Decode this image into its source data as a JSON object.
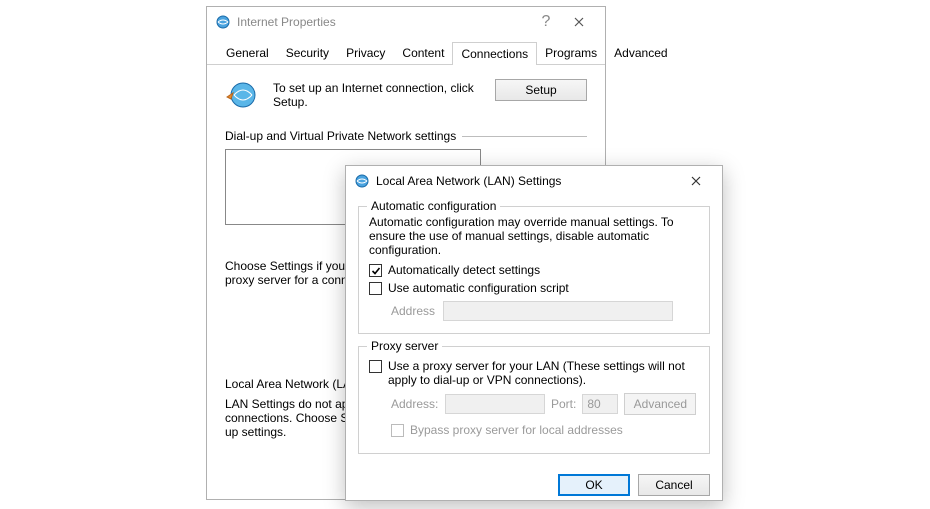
{
  "parent_window": {
    "title": "Internet Properties",
    "tabs": [
      "General",
      "Security",
      "Privacy",
      "Content",
      "Connections",
      "Programs",
      "Advanced"
    ],
    "active_tab_index": 4,
    "setup_text": "To set up an Internet connection, click Setup.",
    "setup_button": "Setup",
    "dialup_label": "Dial-up and Virtual Private Network settings",
    "choose_text": "Choose Settings if you need to configure a proxy server for a connection.",
    "lan_section_label": "Local Area Network (LAN) settings",
    "lan_note": "LAN Settings do not apply to dial-up connections. Choose Settings above for dial-up settings."
  },
  "lan_dialog": {
    "title": "Local Area Network (LAN) Settings",
    "auto_group": {
      "legend": "Automatic configuration",
      "note": "Automatic configuration may override manual settings.  To ensure the use of manual settings, disable automatic configuration.",
      "auto_detect_label": "Automatically detect settings",
      "auto_detect_checked": true,
      "use_script_label": "Use automatic configuration script",
      "use_script_checked": false,
      "address_label": "Address"
    },
    "proxy_group": {
      "legend": "Proxy server",
      "use_proxy_label": "Use a proxy server for your LAN (These settings will not apply to dial-up or VPN connections).",
      "use_proxy_checked": false,
      "address_label": "Address:",
      "address_value": "",
      "port_label": "Port:",
      "port_value": "80",
      "advanced_button": "Advanced",
      "bypass_label": "Bypass proxy server for local addresses",
      "bypass_checked": false
    },
    "ok_button": "OK",
    "cancel_button": "Cancel"
  }
}
